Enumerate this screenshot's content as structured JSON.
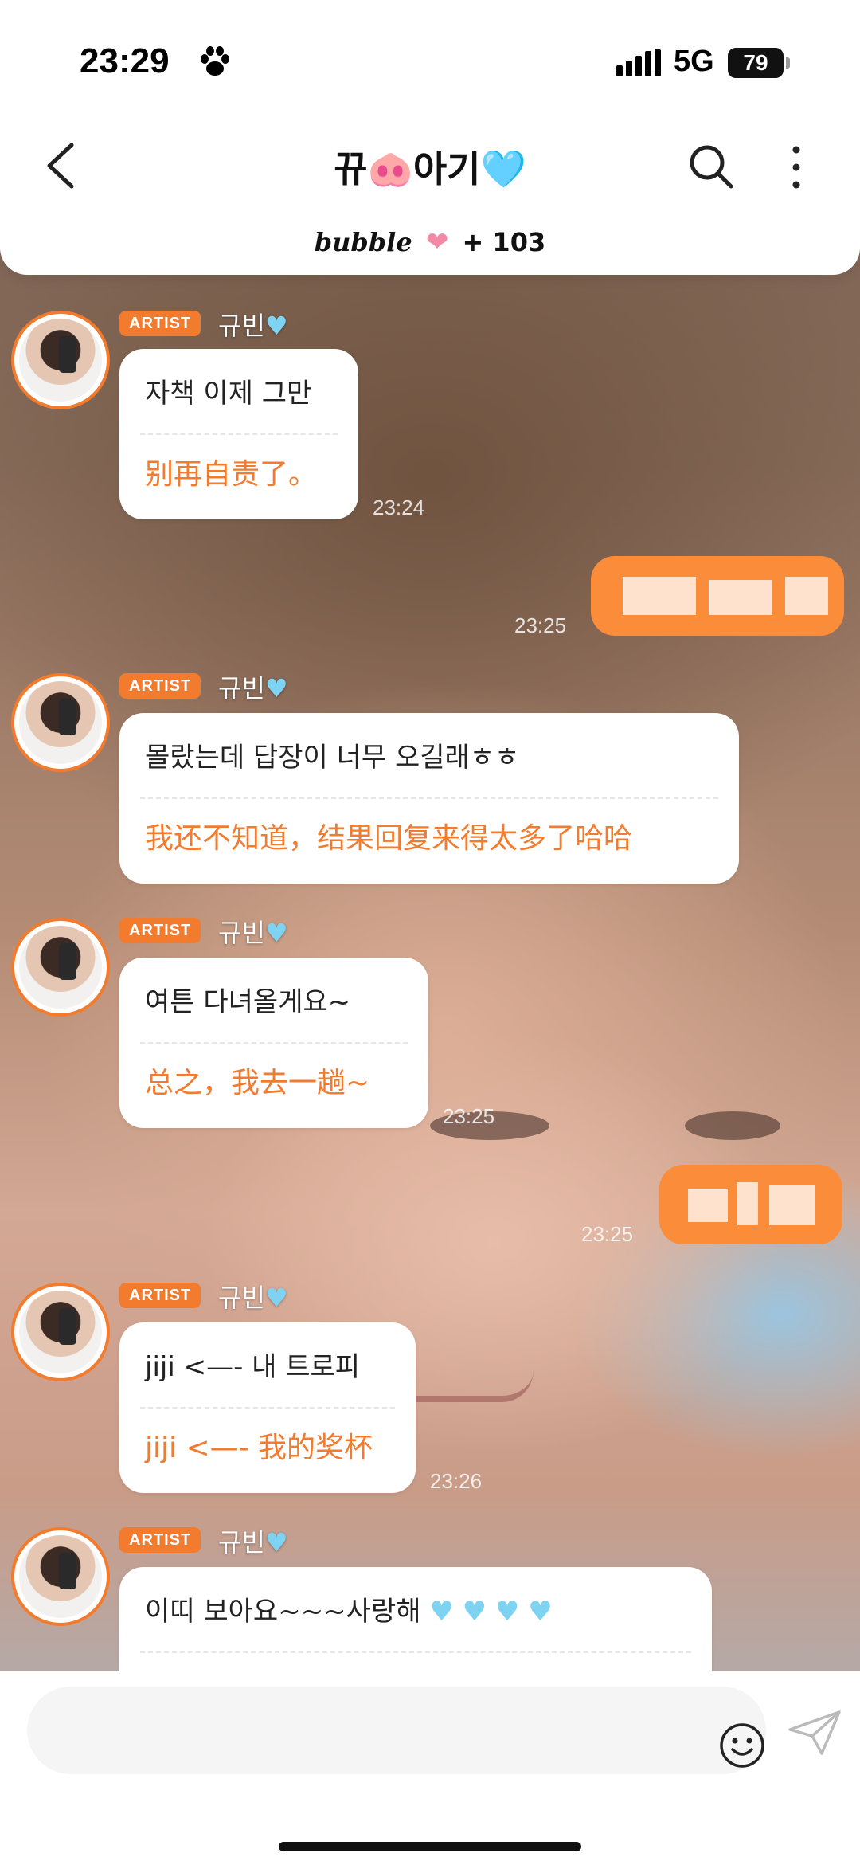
{
  "status_bar": {
    "time": "23:29",
    "network": "5G",
    "battery": "79"
  },
  "header": {
    "title": "뀨🐽아기🩵",
    "back_icon": "chevron-left-icon",
    "search_icon": "search-icon",
    "more_icon": "more-vertical-icon",
    "bubble_brand": "bubble",
    "bubble_count": "+ 103"
  },
  "messages": [
    {
      "badge": "ARTIST",
      "sender": "규빈",
      "ko": "자책 이제 그만",
      "zh": "别再自责了。",
      "time": "23:24"
    },
    {
      "badge": "ARTIST",
      "sender": "규빈",
      "ko": "몰랐는데 답장이 너무 오길래ㅎㅎ",
      "zh": "我还不知道，结果回复来得太多了哈哈",
      "time": ""
    },
    {
      "badge": "ARTIST",
      "sender": "규빈",
      "ko": "여튼 다녀올게요~",
      "zh": "总之，我去一趟~",
      "time": "23:25"
    },
    {
      "badge": "ARTIST",
      "sender": "규빈",
      "ko": "jiji <—- 내 트로피",
      "zh": "jiji <—- 我的奖杯",
      "time": "23:26"
    },
    {
      "badge": "ARTIST",
      "sender": "규빈",
      "ko": "이띠 보아요~~~사랑해",
      "zh": "",
      "time": ""
    }
  ],
  "sent": [
    {
      "time": "23:25"
    },
    {
      "time": "23:25"
    }
  ],
  "input": {
    "placeholder": ""
  },
  "colors": {
    "accent": "#f27b2e",
    "sent_bubble": "#fb8c3a",
    "heart": "#7fd3f2"
  }
}
